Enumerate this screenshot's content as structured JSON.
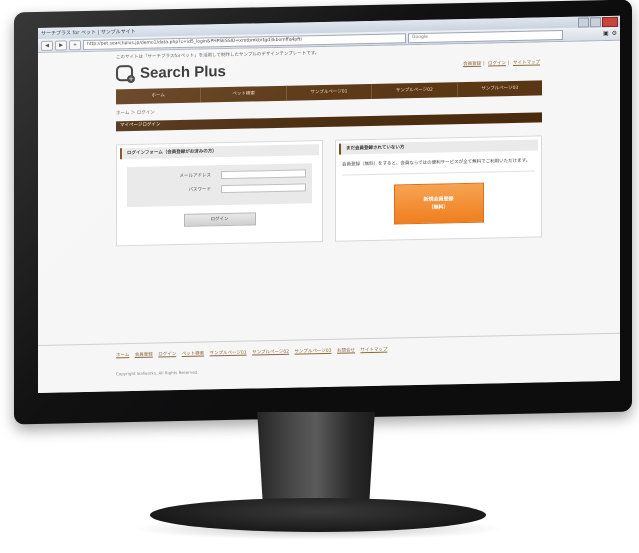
{
  "browser": {
    "window_title": "サーチプラス for ペット | サンプルサイト",
    "url": "http://pet.searchplus.jp/demo1/data.php?c=id5_login&PHPSESSID=xmtbmkbrtgd3kbomffq4pfti",
    "search_placeholder": "Google",
    "nav_back": "◀",
    "nav_forward": "▶",
    "reload": "+"
  },
  "page": {
    "notice": "このサイトは「サーチプラスforペット」を活用して制作したサンプルのデザインテンプレートです。",
    "logo_text": "Search Plus",
    "top_links": [
      "会員登録",
      "ログイン",
      "サイトマップ"
    ],
    "global_nav": [
      "ホーム",
      "ペット検索",
      "サンプルページ01",
      "サンプルページ02",
      "サンプルページ03"
    ],
    "breadcrumb": "ホーム ＞ ログイン",
    "section_title": "マイページログイン",
    "login_box": {
      "heading": "ログインフォーム（会員登録がお済みの方）",
      "email_label": "メールアドレス",
      "password_label": "パスワード",
      "button": "ログイン"
    },
    "register_box": {
      "heading": "まだ会員登録されていない方",
      "description": "会員登録（無料）をすると、会員ならではの便利サービスが全て無料でご利用いただけます。",
      "button_line1": "新規会員登録",
      "button_line2": "（無料）"
    },
    "footer_links": [
      "ホーム",
      "会員登録",
      "ログイン",
      "ペット検索",
      "サンプルページ01",
      "サンプルページ02",
      "サンプルページ03",
      "お問合せ",
      "サイトマップ"
    ],
    "copyright": "Copyright leafworks. All Rights Reserved."
  }
}
